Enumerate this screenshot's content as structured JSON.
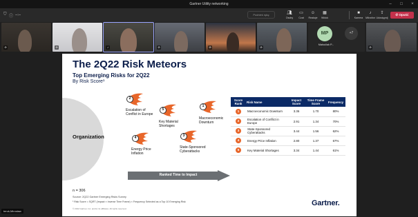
{
  "window": {
    "title": "Gartner Utility networking"
  },
  "toolbar": {
    "timer": "--:--",
    "raise_hand": "Podnieś rękę",
    "buttons": [
      {
        "icon": "people",
        "label": "Osoby"
      },
      {
        "icon": "chat",
        "label": "Czat"
      },
      {
        "icon": "reactions",
        "label": "Reakcje"
      },
      {
        "icon": "view",
        "label": "Widok"
      },
      {
        "icon": "camera",
        "label": "Kamera"
      },
      {
        "icon": "mic",
        "label": "Mikrofon"
      },
      {
        "icon": "share",
        "label": "Udostępnij"
      }
    ],
    "leave": "Opuść"
  },
  "participants": {
    "avatar_initials": "MP",
    "avatar_name": "Matouliak P...",
    "more": "+7"
  },
  "slide": {
    "title": "The 2Q22 Risk Meteors",
    "subtitle": "Top Emerging Risks for 2Q22",
    "subtitle2": "By Risk Score¹",
    "org_label": "Organization",
    "arrow_label": "Ranked Time to Impact",
    "n": "n = 306",
    "source": "Source: 2Q22 Gartner Emerging Risks Survey",
    "footnote": "¹ Risk Score = SQRT (Impact × Inverse Time Frame) × Frequency Selected as a Top 10 Emerging Risk",
    "copyright": "© 2022 Gartner, Inc. and/or its affiliates. All rights reserved.",
    "logo": "Gartner",
    "meteors": [
      {
        "rank": "2",
        "label": "Escalation of Conflict in Europe"
      },
      {
        "rank": "5",
        "label": "Key Material Shortages"
      },
      {
        "rank": "1",
        "label": "Macroeconomic Downturn"
      },
      {
        "rank": "4",
        "label": "Energy Price Inflation"
      },
      {
        "rank": "3",
        "label": "State-Sponsored Cyberattacks"
      }
    ],
    "table": {
      "headers": [
        "Score Rank",
        "Risk Name",
        "Impact Score",
        "Time Frame Score",
        "Frequency"
      ],
      "rows": [
        {
          "rank": "1",
          "name": "Macroeconomic Downturn",
          "impact": "3.36",
          "time": "1.70",
          "freq": "80%"
        },
        {
          "rank": "2",
          "name": "Escalation of Conflict in Europe",
          "impact": "2.91",
          "time": "1.34",
          "freq": "70%"
        },
        {
          "rank": "3",
          "name": "State-Sponsored Cyberattacks",
          "impact": "3.44",
          "time": "1.56",
          "freq": "62%"
        },
        {
          "rank": "4",
          "name": "Energy Price Inflation",
          "impact": "2.80",
          "time": "1.37",
          "freq": "67%"
        },
        {
          "rank": "5",
          "name": "Key Material Shortages",
          "impact": "3.34",
          "time": "1.44",
          "freq": "61%"
        }
      ]
    }
  },
  "self_view": {
    "name": "teruk,Mirosław"
  },
  "colors": {
    "accent": "#0b2a66",
    "meteor": "#e8662a",
    "leave": "#c4314b"
  }
}
